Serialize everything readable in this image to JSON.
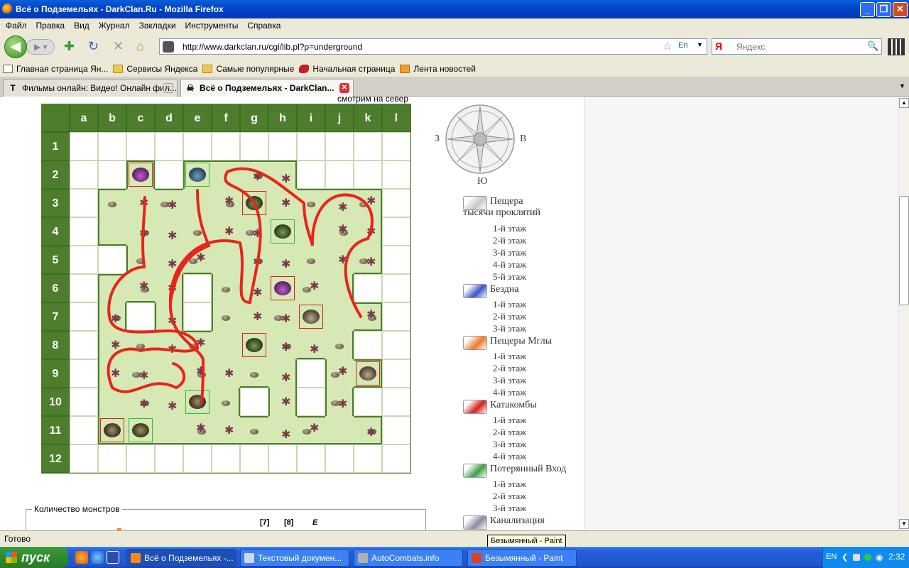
{
  "window": {
    "title": "Всё о Подземельях - DarkClan.Ru - Mozilla Firefox",
    "minimize": "_",
    "maximize": "❐",
    "close": "✕"
  },
  "menu": [
    "Файл",
    "Правка",
    "Вид",
    "Журнал",
    "Закладки",
    "Инструменты",
    "Справка"
  ],
  "nav": {
    "url": "http://www.darkclan.ru/cgi/lib.pl?p=underground",
    "search_placeholder": "Яндекс",
    "search_engine": "Я"
  },
  "bookmarks": [
    {
      "label": "Главная страница Ян...",
      "icon": "page-icon"
    },
    {
      "label": "Сервисы Яндекса",
      "icon": "folder-icon"
    },
    {
      "label": "Самые популярные",
      "icon": "folder-icon"
    },
    {
      "label": "Начальная страница",
      "icon": "red-bird-icon"
    },
    {
      "label": "Лента новостей",
      "icon": "rss-icon"
    }
  ],
  "tabs": [
    {
      "label": "Фильмы онлайн: Видео! Онлайн фил...",
      "active": false,
      "icon": "T"
    },
    {
      "label": "Всё о Подземельях - DarkClan...",
      "active": true,
      "icon": "☠"
    }
  ],
  "map": {
    "look_north": "смотрим на север",
    "columns": [
      "a",
      "b",
      "c",
      "d",
      "e",
      "f",
      "g",
      "h",
      "i",
      "j",
      "k",
      "l"
    ],
    "rows": [
      "1",
      "2",
      "3",
      "4",
      "5",
      "6",
      "7",
      "8",
      "9",
      "10",
      "11",
      "12"
    ],
    "floor_color": "#d6e8b4",
    "wall_color": "#4d7d2d",
    "path_color": "#e8241b",
    "floor_cells": [
      "c2",
      "e2",
      "f2",
      "g2",
      "h2",
      "b3",
      "c3",
      "d3",
      "e3",
      "f3",
      "g3",
      "h3",
      "i3",
      "j3",
      "k3",
      "b4",
      "c4",
      "d4",
      "e4",
      "f4",
      "g4",
      "h4",
      "i4",
      "j4",
      "k4",
      "c5",
      "d5",
      "e5",
      "f5",
      "g5",
      "h5",
      "i5",
      "j5",
      "k5",
      "b6",
      "c6",
      "d6",
      "f6",
      "g6",
      "h6",
      "i6",
      "j6",
      "b7",
      "d7",
      "f7",
      "g7",
      "h7",
      "i7",
      "j7",
      "k7",
      "b8",
      "c8",
      "d8",
      "e8",
      "f8",
      "g8",
      "h8",
      "i8",
      "j8",
      "b9",
      "c9",
      "d9",
      "e9",
      "f9",
      "g9",
      "h9",
      "j9",
      "k9",
      "b10",
      "c10",
      "d10",
      "e10",
      "f10",
      "h10",
      "j10",
      "b11",
      "c11",
      "d11",
      "e11",
      "f11",
      "g11",
      "h11",
      "i11",
      "j11",
      "k11"
    ],
    "monsters": [
      {
        "cell": "c2",
        "frame": "red",
        "icon": "purple-slime-icon"
      },
      {
        "cell": "e2",
        "frame": "grn",
        "icon": "crab-icon"
      },
      {
        "cell": "g3",
        "frame": "red",
        "icon": "green-slug-icon"
      },
      {
        "cell": "h4",
        "frame": "grn",
        "icon": "green-slug-icon"
      },
      {
        "cell": "h6",
        "frame": "red",
        "icon": "purple-slime-icon"
      },
      {
        "cell": "i7",
        "frame": "red",
        "icon": "rock-beast-icon"
      },
      {
        "cell": "g8",
        "frame": "red",
        "icon": "green-slug-icon"
      },
      {
        "cell": "k9",
        "frame": "red",
        "icon": "rock-beast-icon"
      },
      {
        "cell": "e10",
        "frame": "grn",
        "icon": "shell-beast-icon"
      },
      {
        "cell": "b11",
        "frame": "red",
        "icon": "shell-beast-icon"
      },
      {
        "cell": "c11",
        "frame": "grn",
        "icon": "cocoon-icon"
      }
    ]
  },
  "compass": {
    "west": "З",
    "east": "В",
    "south": "Ю"
  },
  "dungeons": [
    {
      "name": "Пещера тысячи проклятий",
      "floors": [
        "1-й этаж",
        "2-й этаж",
        "3-й этаж",
        "4-й этаж",
        "5-й этаж"
      ],
      "icon": "fortress-icon",
      "color": "#c9c9c9"
    },
    {
      "name": "Бездна",
      "floors": [
        "1-й этаж",
        "2-й этаж",
        "3-й этаж"
      ],
      "icon": "abyss-icon",
      "color": "#3b55c9"
    },
    {
      "name": "Пещеры Мглы",
      "floors": [
        "1-й этаж",
        "2-й этаж",
        "3-й этаж",
        "4-й этаж"
      ],
      "icon": "fire-icon",
      "color": "#f07a2a"
    },
    {
      "name": "Катакомбы",
      "floors": [
        "1-й этаж",
        "2-й этаж",
        "3-й этаж",
        "4-й этаж"
      ],
      "icon": "catacomb-icon",
      "color": "#d42222"
    },
    {
      "name": "Потерянный Вход",
      "floors": [
        "1-й этаж",
        "2-й этаж",
        "3-й этаж"
      ],
      "icon": "lost-entrance-icon",
      "color": "#3aa04a"
    },
    {
      "name": "Канализация",
      "floors": [
        "1-й этаж"
      ],
      "icon": "sewer-icon",
      "color": "#8a8aa0"
    }
  ],
  "monster_count": {
    "legend": "Количество монстров",
    "links": [
      "[7]",
      "[8]",
      "E"
    ]
  },
  "status": "Готово",
  "tooltip": "Безымянный - Paint",
  "taskbar": {
    "start": "пуск",
    "tasks": [
      {
        "label": "Всё о Подземельях -...",
        "active": true,
        "color": "#f08a1a"
      },
      {
        "label": "Текстовый докумен...",
        "active": false,
        "color": "#cfd8e8"
      },
      {
        "label": "AutoCombats.info",
        "active": false,
        "color": "#b0b0b0"
      },
      {
        "label": "Безымянный - Paint",
        "active": false,
        "color": "#e04020"
      }
    ],
    "lang": "EN",
    "clock": "2:32"
  }
}
